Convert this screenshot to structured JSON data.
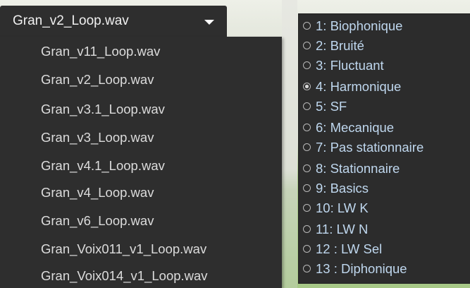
{
  "dropdown": {
    "selected": "Gran_v2_Loop.wav",
    "options": [
      "Gran_v11_Loop.wav",
      "Gran_v2_Loop.wav",
      "Gran_v3.1_Loop.wav",
      "Gran_v3_Loop.wav",
      "Gran_v4.1_Loop.wav",
      "Gran_v4_Loop.wav",
      "Gran_v6_Loop.wav",
      "Gran_Voix011_v1_Loop.wav",
      "Gran_Voix014_v1_Loop.wav"
    ]
  },
  "radio_group": {
    "selected_index": 3,
    "options": [
      "1: Biophonique",
      "2: Bruité",
      "3: Fluctuant",
      "4: Harmonique",
      "5: SF",
      "6: Mecanique",
      "7: Pas stationnaire",
      "8: Stationnaire",
      "9: Basics",
      "10: LW K",
      "11: LW N",
      "12 : LW Sel",
      "13 : Diphonique"
    ]
  },
  "colors": {
    "panel_bg": "#2e2e2e",
    "dropdown_text": "#dcdcdc",
    "radio_text": "#bfd7ee",
    "background_green": "#a7c887"
  }
}
